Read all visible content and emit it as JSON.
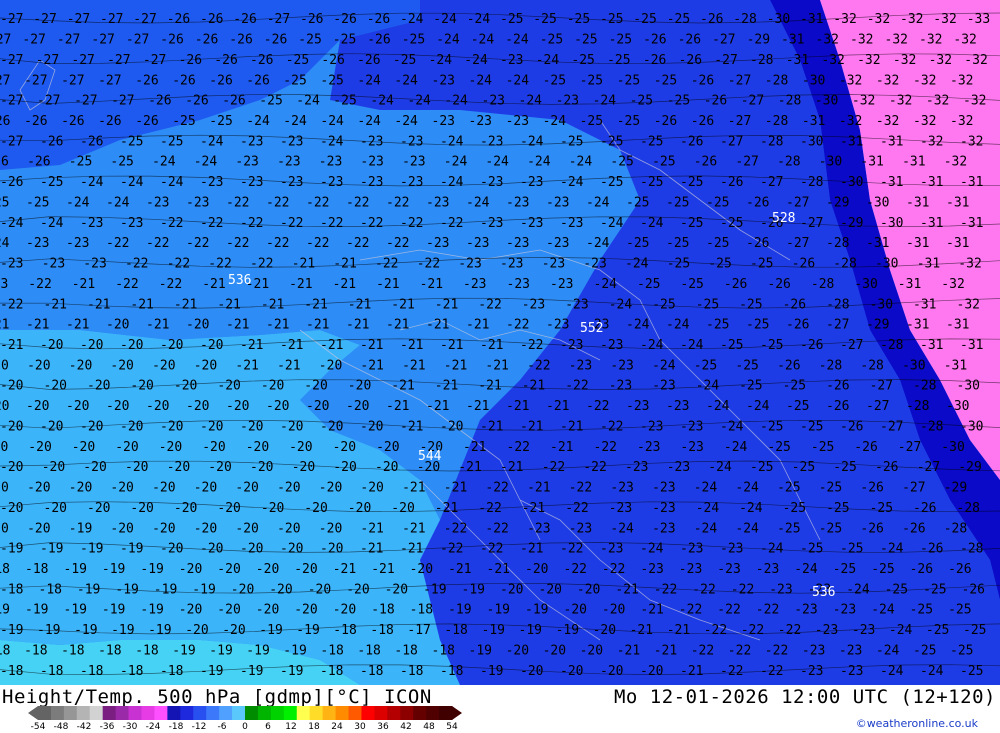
{
  "title": {
    "left": "Height/Temp. 500 hPa [gdmp][°C] ICON",
    "right": "Mo 12-01-2026 12:00 UTC (12+120)"
  },
  "credit": "©weatheronline.co.uk",
  "legend": {
    "ticks": [
      "-54",
      "-48",
      "-42",
      "-36",
      "-30",
      "-24",
      "-18",
      "-12",
      "-6",
      "0",
      "6",
      "12",
      "18",
      "24",
      "30",
      "36",
      "42",
      "48",
      "54"
    ],
    "colors": [
      "#646464",
      "#7c7c7c",
      "#969696",
      "#b4b4b4",
      "#d2d2d2",
      "#7a1e82",
      "#9b2aa8",
      "#c832d2",
      "#e63ce6",
      "#ff50ff",
      "#1414b4",
      "#1e28dc",
      "#2850f0",
      "#3c78fa",
      "#50a0ff",
      "#5ac8fa",
      "#008c00",
      "#00b400",
      "#00d200",
      "#00f000",
      "#ffff50",
      "#ffdc28",
      "#ffb414",
      "#ff8c00",
      "#ff5a00",
      "#ff0000",
      "#dc0000",
      "#b40000",
      "#8c0000",
      "#640000",
      "#500000",
      "#400000"
    ]
  },
  "zones": {
    "warm": "#46d2f5",
    "mild": "#3cb4fa",
    "cool": "#2d8cf5",
    "cold": "#1e5af0",
    "colder": "#1e3ce6",
    "coldest": "#0a0ac8",
    "extreme": "#ff78f0"
  },
  "height_labels": [
    "536",
    "544",
    "552",
    "528",
    "536"
  ],
  "rows": [
    "27 27 27 27 27 26 26 26 27 26 26 26 24 24 24 25 25 25 25 25 25 26 28 30 31 32 32 32 32 33",
    "27 27 27 27 27 26 26 26 26 25 25 26 25 24 24 24 25 25 25 26 26 27 29 31 32 32 32 32 32",
    "27 27 27 27 27 26 26 26 25 26 26 25 24 24 23 24 25 25 26 26 27 28 31 32 32 32 32 32",
    "27 27 27 27 26 26 26 26 25 25 24 24 23 24 24 25 25 25 25 26 27 28 30 32 32 32 32",
    "27 27 27 27 26 26 26 25 24 25 24 24 24 23 24 23 24 25 25 26 27 28 30 32 32 32 32",
    "26 26 26 26 26 25 25 24 24 24 24 24 23 23 23 24 25 25 26 26 27 28 31 32 32 32 32",
    "27 26 26 25 25 24 23 23 24 23 23 24 23 24 25 25 25 26 27 28 30 31 31 32 32",
    "26 26 25 25 24 24 23 23 23 23 23 24 24 24 24 25 25 26 27 28 30 31 31 32",
    "26 25 24 24 24 23 23 23 23 23 23 24 23 23 24 25 25 25 26 27 28 30 31 31 31",
    "25 25 24 24 23 23 22 22 22 22 22 23 24 23 23 24 25 25 25 26 27 29 30 31 31",
    "24 24 23 23 22 22 22 22 22 22 22 22 23 23 23 24 24 25 25 26 27 29 30 31 31",
    "24 23 23 22 22 22 22 22 22 22 22 23 23 23 23 24 25 25 25 26 27 28 31 31 31",
    "23 23 23 22 22 22 22 21 21 22 22 23 23 23 23 24 25 25 25 26 28 30 31 32",
    "23 22 21 22 22 21 21 21 21 21 21 23 23 23 24 25 25 26 26 28 30 31 32",
    "22 21 21 21 21 21 21 21 21 21 21 22 23 23 24 25 25 25 26 28 30 31 32",
    "21 21 21 20 21 20 21 21 21 21 21 21 21 22 23 23 24 24 25 25 26 27 29 31 31",
    "21 20 20 20 20 20 21 21 21 21 21 21 21 22 23 23 24 24 25 25 26 27 28 31 31",
    "20 20 20 20 20 20 21 21 20 21 21 21 21 22 23 23 24 25 25 26 28 28 30 31",
    "20 20 20 20 20 20 20 20 20 21 21 21 21 22 23 23 24 25 25 26 27 28 30",
    "20 20 20 20 20 20 20 20 20 20 21 21 21 21 21 22 23 23 24 24 25 26 27 28 30",
    "20 20 20 20 20 20 20 20 20 20 21 20 21 21 21 22 23 23 24 25 25 26 27 28 30",
    "20 20 20 20 20 20 20 20 20 20 20 21 22 21 22 23 23 24 25 25 26 27 30",
    "20 20 20 20 20 20 20 20 20 20 20 21 21 22 22 23 23 24 25 25 25 26 27 29",
    "20 20 20 20 20 20 20 20 20 20 21 21 22 21 22 23 23 24 24 25 25 26 27 29",
    "20 20 20 20 20 20 20 20 20 20 21 22 21 22 23 23 24 24 25 25 25 26 28",
    "20 20 19 20 20 20 20 20 20 21 21 22 22 23 23 24 23 24 24 25 25 26 26 28",
    "19 19 19 19 20 20 20 20 20 21 21 22 22 21 22 23 24 23 23 24 25 25 24 26 28",
    "18 18 19 19 19 20 20 20 20 21 21 20 21 21 20 22 22 23 23 23 23 24 25 25 26 26",
    "18 18 19 19 19 19 20 20 20 20 20 19 19 20 20 20 21 22 22 22 23 23 24 25 25 26",
    "19 19 19 19 19 20 20 20 20 20 18 18 19 19 19 20 20 21 22 22 22 23 23 24 25 25",
    "19 19 19 19 19 20 20 19 19 18 18 17 18 19 19 19 20 21 21 22 22 22 23 23 24 25 25",
    "18 18 18 18 18 19 19 19 19 18 18 18 18 19 20 20 20 21 21 22 22 22 23 23 24 25 25",
    "18 18 18 18 18 19 19 19 18 18 18 18 19 20 20 20 20 21 22 22 23 23 24 24 25"
  ]
}
